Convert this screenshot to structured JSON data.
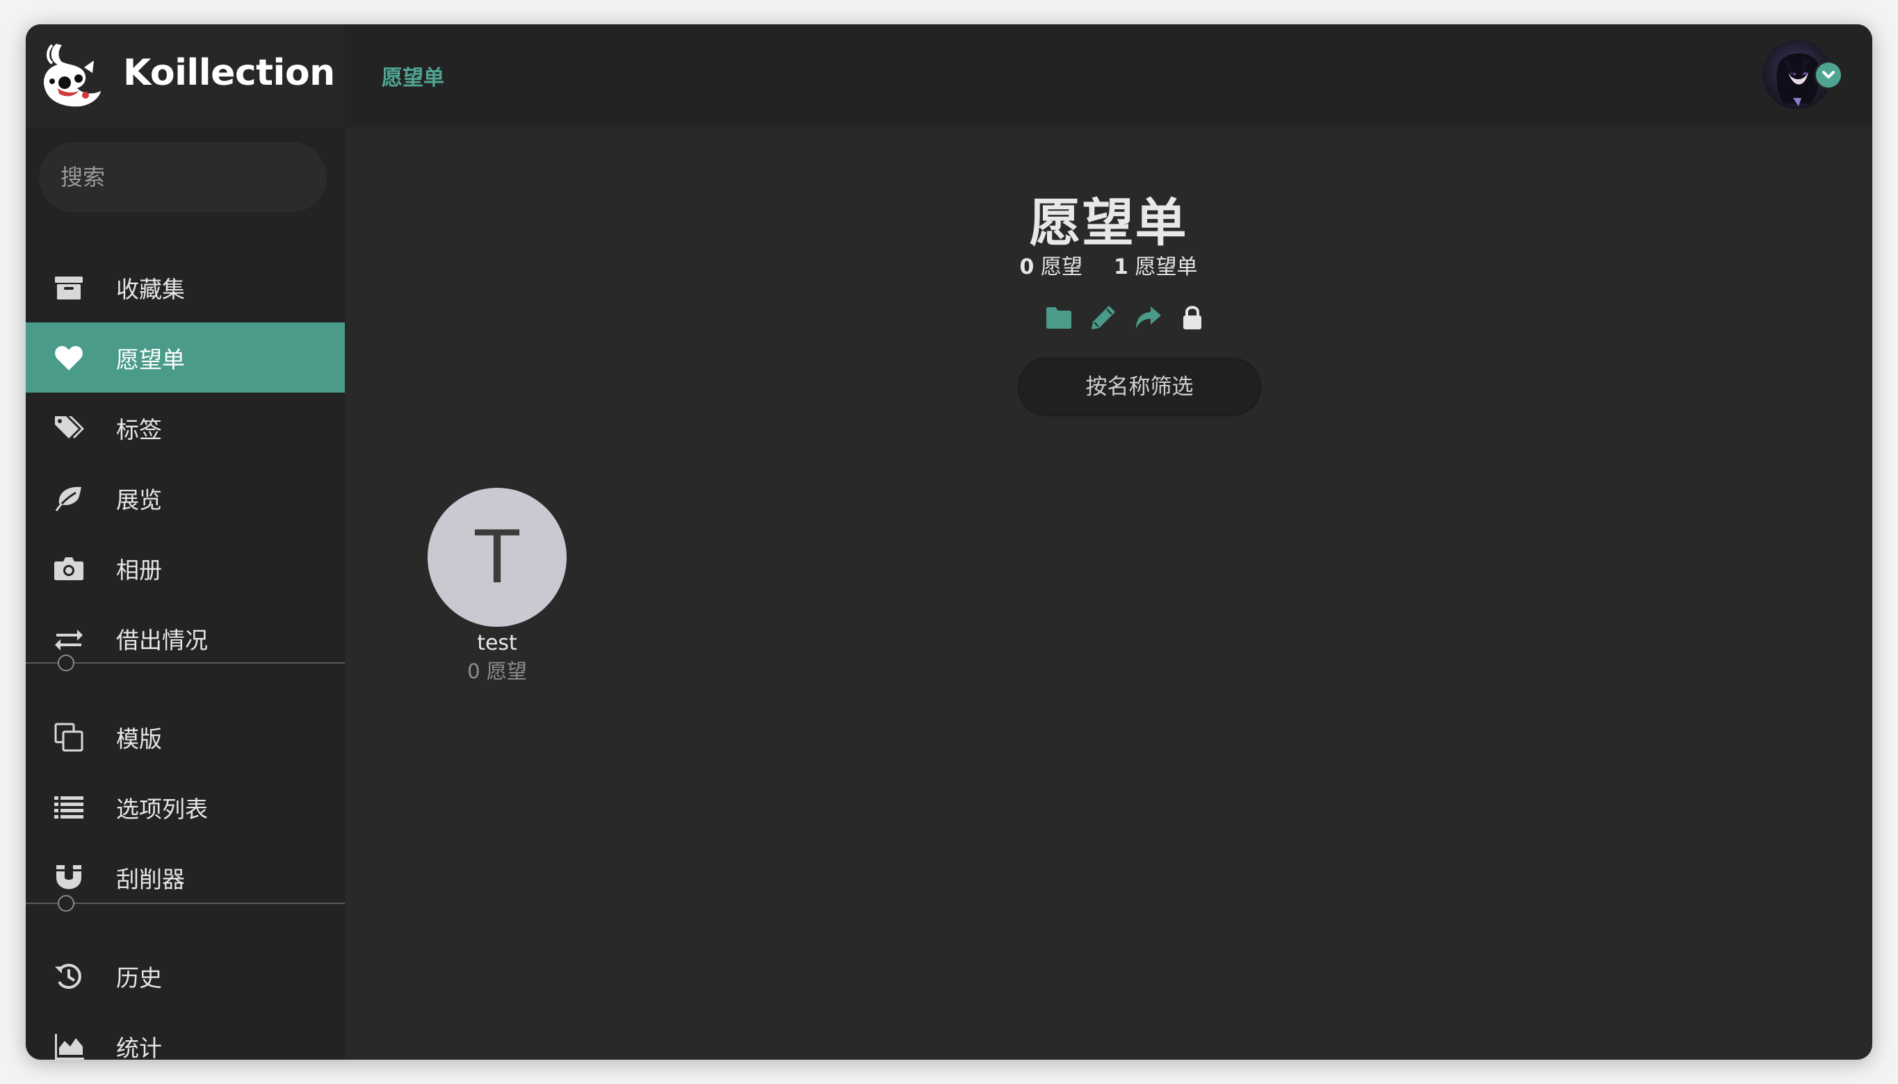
{
  "app": {
    "name": "Koillection"
  },
  "search": {
    "placeholder": "搜索"
  },
  "sidebar": {
    "items": [
      {
        "label": "收藏集",
        "icon": "archive-icon",
        "active": false
      },
      {
        "label": "愿望单",
        "icon": "heart-icon",
        "active": true
      },
      {
        "label": "标签",
        "icon": "tags-icon",
        "active": false
      },
      {
        "label": "展览",
        "icon": "leaf-icon",
        "active": false
      },
      {
        "label": "相册",
        "icon": "camera-icon",
        "active": false
      },
      {
        "label": "借出情况",
        "icon": "exchange-icon",
        "active": false
      },
      {
        "label": "模版",
        "icon": "copy-icon",
        "active": false
      },
      {
        "label": "选项列表",
        "icon": "list-icon",
        "active": false
      },
      {
        "label": "刮削器",
        "icon": "magnet-icon",
        "active": false
      },
      {
        "label": "历史",
        "icon": "history-icon",
        "active": false
      },
      {
        "label": "统计",
        "icon": "area-chart-icon",
        "active": false
      }
    ]
  },
  "header": {
    "breadcrumb": "愿望单"
  },
  "main": {
    "title": "愿望单",
    "counts": {
      "wishes_value": "0",
      "wishes_label": "愿望",
      "wishlists_value": "1",
      "wishlists_label": "愿望单"
    },
    "filter": {
      "placeholder": "按名称筛选"
    },
    "wishlists": [
      {
        "initial": "T",
        "name": "test",
        "count": "0 愿望"
      }
    ]
  },
  "colors": {
    "accent": "#4a9b8a",
    "accent_text": "#4fa492",
    "sidebar_bg": "#232323",
    "main_bg": "#292929"
  }
}
